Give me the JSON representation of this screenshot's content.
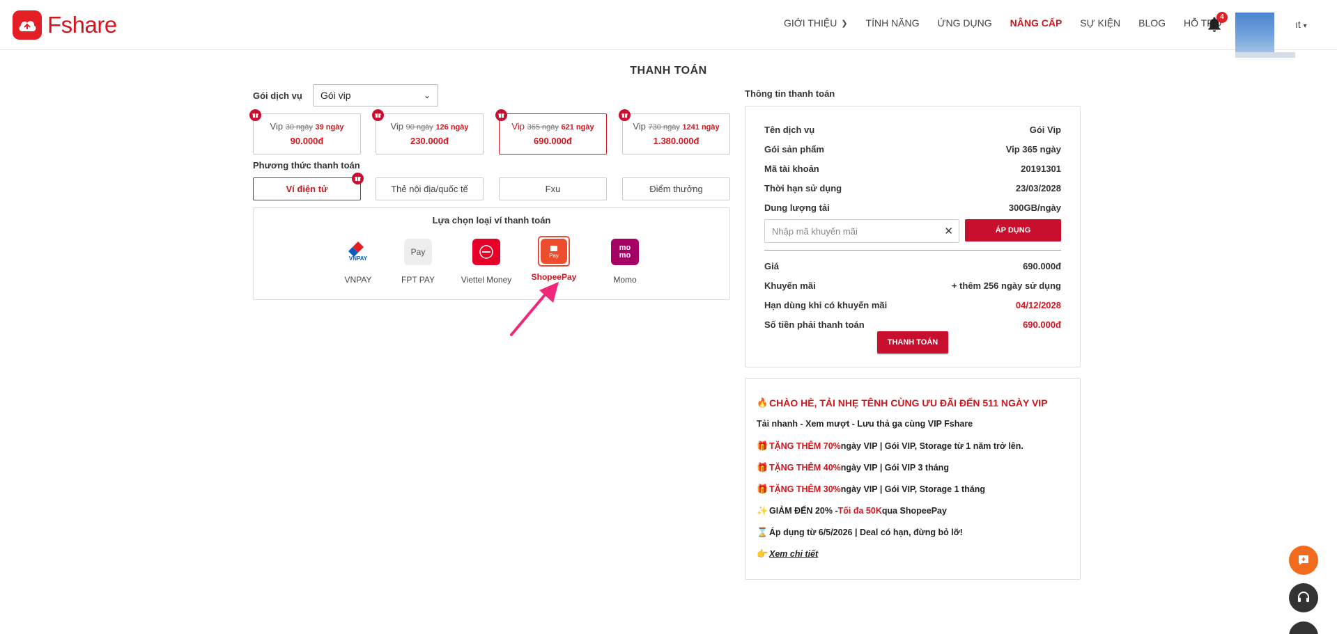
{
  "brand": {
    "name": "Fshare",
    "accent": "#d0161e"
  },
  "nav": {
    "items": [
      {
        "label": "GIỚI THIỆU",
        "has_dropdown": true
      },
      {
        "label": "TÍNH NĂNG"
      },
      {
        "label": "ỨNG DỤNG"
      },
      {
        "label": "NÂNG CẤP",
        "active": true
      },
      {
        "label": "SỰ KIỆN"
      },
      {
        "label": "BLOG"
      },
      {
        "label": "HỖ TRỢ"
      }
    ],
    "notification_count": "4",
    "user_tail": "ıt"
  },
  "page_title": "THANH TOÁN",
  "service": {
    "label": "Gói dịch vụ",
    "selected": "Gói vip"
  },
  "plans": [
    {
      "prefix": "Vip",
      "old": "30 ngày",
      "new": "39 ngày",
      "price": "90.000đ"
    },
    {
      "prefix": "Vip",
      "old": "90 ngày",
      "new": "126 ngày",
      "price": "230.000đ"
    },
    {
      "prefix": "Vip",
      "old": "365 ngày",
      "new": "621 ngày",
      "price": "690.000đ",
      "selected": true
    },
    {
      "prefix": "Vip",
      "old": "730 ngày",
      "new": "1241 ngày",
      "price": "1.380.000đ"
    }
  ],
  "payment_method": {
    "title": "Phương thức thanh toán",
    "options": [
      "Ví điện tử",
      "Thẻ nội địa/quốc tế",
      "Fxu",
      "Điểm thưởng"
    ],
    "active": "Ví điện tử"
  },
  "wallets": {
    "title": "Lựa chọn loại ví thanh toán",
    "items": [
      {
        "name": "VNPAY",
        "icon": "vnpay-icon"
      },
      {
        "name": "FPT PAY",
        "icon": "fpt-pay-icon",
        "badge": "Pay"
      },
      {
        "name": "Viettel Money",
        "icon": "viettel-money-icon"
      },
      {
        "name": "ShopeePay",
        "icon": "shopeepay-icon",
        "badge": "Pay",
        "selected": true
      },
      {
        "name": "Momo",
        "icon": "momo-icon",
        "badge_top": "mo",
        "badge_bottom": "mo"
      }
    ]
  },
  "info": {
    "title": "Thông tin thanh toán",
    "rows": [
      {
        "k": "Tên dịch vụ",
        "v": "Gói Vip"
      },
      {
        "k": "Gói sản phẩm",
        "v": "Vip 365 ngày"
      },
      {
        "k": "Mã tài khoản",
        "v": "20191301"
      },
      {
        "k": "Thời hạn sử dụng",
        "v": "23/03/2028"
      },
      {
        "k": "Dung lượng tải",
        "v": "300GB/ngày"
      }
    ],
    "promo_placeholder": "Nhập mã khuyến mãi",
    "apply_label": "ÁP DỤNG",
    "summary": [
      {
        "k": "Giá",
        "v": "690.000đ"
      },
      {
        "k": "Khuyến mãi",
        "v": "+ thêm 256 ngày sử dụng"
      },
      {
        "k": "Hạn dùng khi có khuyến mãi",
        "v": "04/12/2028",
        "red": true
      },
      {
        "k": "Số tiền phải thanh toán",
        "v": "690.000đ",
        "red": true
      }
    ],
    "pay_label": "THANH TOÁN"
  },
  "promo": {
    "headline": "CHÀO HÈ, TẢI NHẸ TÊNH CÙNG ƯU ĐÃI ĐẾN 511 NGÀY VIP",
    "subline": "Tải nhanh - Xem mượt - Lưu thả ga cùng VIP Fshare",
    "offers": [
      {
        "red": "TẶNG THÊM 70%",
        "rest": " ngày VIP | Gói VIP, Storage từ 1 năm trở lên."
      },
      {
        "red": "TẶNG THÊM 40%",
        "rest": " ngày VIP | Gói VIP 3 tháng"
      },
      {
        "red": "TẶNG THÊM 30%",
        "rest": " ngày VIP | Gói VIP, Storage 1 tháng"
      }
    ],
    "shopee_a": "GIẢM ĐẾN 20% - ",
    "shopee_red": "Tối đa 50K",
    "shopee_b": " qua ShopeePay",
    "apply_date": "Áp dụng từ 6/5/2026 | Deal có hạn, đừng bỏ lỡ!",
    "details_link": "Xem chi tiết"
  }
}
